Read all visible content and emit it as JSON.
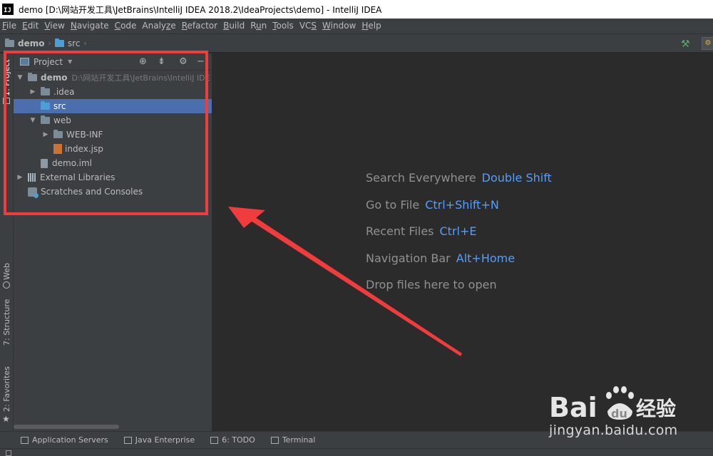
{
  "window": {
    "logo_letter": "IJ",
    "title": "demo [D:\\网站开发工具\\JetBrains\\IntelliJ IDEA 2018.2\\IdeaProjects\\demo] - IntelliJ IDEA"
  },
  "menu": [
    {
      "pre": "",
      "mn": "F",
      "post": "ile"
    },
    {
      "pre": "",
      "mn": "E",
      "post": "dit"
    },
    {
      "pre": "",
      "mn": "V",
      "post": "iew"
    },
    {
      "pre": "",
      "mn": "N",
      "post": "avigate"
    },
    {
      "pre": "",
      "mn": "C",
      "post": "ode"
    },
    {
      "pre": "Analy",
      "mn": "z",
      "post": "e"
    },
    {
      "pre": "",
      "mn": "R",
      "post": "efactor"
    },
    {
      "pre": "",
      "mn": "B",
      "post": "uild"
    },
    {
      "pre": "R",
      "mn": "u",
      "post": "n"
    },
    {
      "pre": "",
      "mn": "T",
      "post": "ools"
    },
    {
      "pre": "VC",
      "mn": "S",
      "post": ""
    },
    {
      "pre": "",
      "mn": "W",
      "post": "indow"
    },
    {
      "pre": "",
      "mn": "H",
      "post": "elp"
    }
  ],
  "breadcrumb": {
    "project": "demo",
    "folder": "src"
  },
  "left_tabs": {
    "project": "1: Project",
    "web": "Web",
    "structure": "7: Structure",
    "favorites": "2: Favorites"
  },
  "project_panel": {
    "title": "Project",
    "tree": [
      {
        "label": "demo",
        "hint": "D:\\网站开发工具\\JetBrains\\IntelliJ IDE",
        "level": 0,
        "arrow": "down",
        "icon": "module",
        "bold": true
      },
      {
        "label": ".idea",
        "level": 1,
        "arrow": "right",
        "icon": "folder"
      },
      {
        "label": "src",
        "level": 1,
        "arrow": "none",
        "icon": "folder-blue",
        "selected": true
      },
      {
        "label": "web",
        "level": 1,
        "arrow": "down",
        "icon": "folder"
      },
      {
        "label": "WEB-INF",
        "level": 2,
        "arrow": "right",
        "icon": "folder"
      },
      {
        "label": "index.jsp",
        "level": 2,
        "arrow": "none",
        "icon": "jsp"
      },
      {
        "label": "demo.iml",
        "level": 1,
        "arrow": "none",
        "icon": "iml"
      },
      {
        "label": "External Libraries",
        "level": 0,
        "arrow": "right",
        "icon": "lib"
      },
      {
        "label": "Scratches and Consoles",
        "level": 0,
        "arrow": "none",
        "icon": "scratch"
      }
    ]
  },
  "editor_hints": [
    {
      "label": "Search Everywhere",
      "key": "Double Shift"
    },
    {
      "label": "Go to File",
      "key": "Ctrl+Shift+N"
    },
    {
      "label": "Recent Files",
      "key": "Ctrl+E"
    },
    {
      "label": "Navigation Bar",
      "key": "Alt+Home"
    },
    {
      "label": "Drop files here to open",
      "key": ""
    }
  ],
  "bottom_tabs": [
    {
      "label": "Application Servers"
    },
    {
      "label": "Java Enterprise"
    },
    {
      "label": "6: TODO"
    },
    {
      "label": "Terminal"
    }
  ],
  "watermark": {
    "brand_a": "Bai",
    "brand_b": "du",
    "brand_cn": "经验",
    "url": "jingyan.baidu.com"
  },
  "colors": {
    "accent": "#589df6",
    "selection": "#4b6eaf",
    "annotation": "#f03c3c"
  }
}
